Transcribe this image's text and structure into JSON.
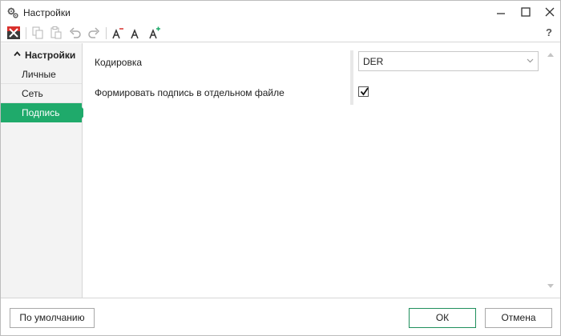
{
  "window": {
    "title": "Настройки",
    "title_icon": "gears-icon",
    "controls": [
      "minimize-icon",
      "maximize-icon",
      "close-icon"
    ]
  },
  "toolbar": {
    "icons": [
      "app-logo-icon",
      "copy-icon",
      "paste-icon",
      "undo-icon",
      "redo-icon",
      "font-decrease-icon",
      "font-normal-icon",
      "font-increase-icon"
    ],
    "help_label": "?"
  },
  "sidebar": {
    "group_label": "Настройки",
    "items": [
      {
        "label": "Личные",
        "selected": false
      },
      {
        "label": "Сеть",
        "selected": false
      },
      {
        "label": "Подпись",
        "selected": true
      }
    ]
  },
  "main": {
    "encoding_label": "Кодировка",
    "encoding_value": "DER",
    "separate_file_label": "Формировать подпись в отдельном файле",
    "separate_file_checked": true
  },
  "footer": {
    "default_label": "По умолчанию",
    "ok_label": "ОК",
    "cancel_label": "Отмена"
  },
  "colors": {
    "accent": "#1faa6b",
    "border": "#d6d6d6",
    "sidebar_bg": "#f3f3f3"
  }
}
